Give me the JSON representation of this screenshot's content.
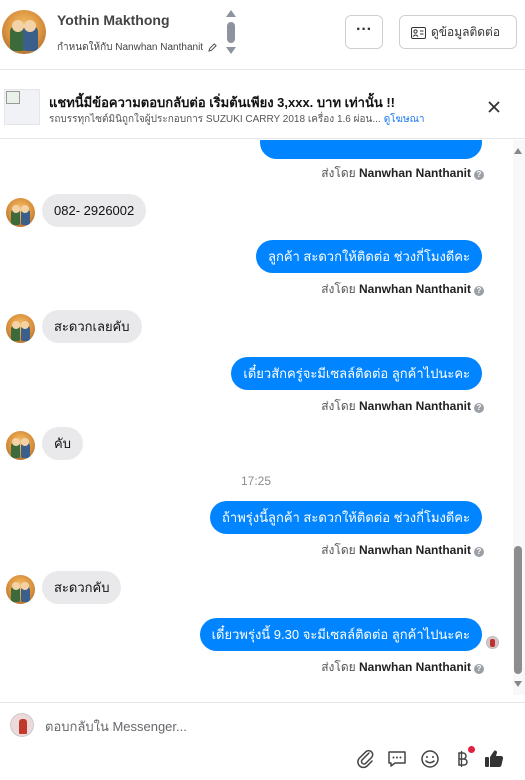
{
  "header": {
    "contact_name": "Yothin Makthong",
    "assigned_text": "กำหนดให้กับ Nanwhan Nanthanit",
    "more_label": "···",
    "info_label": "ดูข้อมูลติดต่อ"
  },
  "ad": {
    "title": "แชทนี้มีข้อความตอบกลับต่อ เริ่มต้นเพียง 3,xxx. บาท เท่านั้น !!",
    "description": "รถบรรทุกไซต์มินิถูกใจผู้ประกอบการ SUZUKI CARRY 2018 เครื่อง 1.6 ผ่อน...",
    "link": "ดูโฆษณา"
  },
  "messages": [
    {
      "dir": "out",
      "text": "",
      "partial": true
    },
    {
      "dir": "sent_by",
      "prefix": "ส่งโดย",
      "name": "Nanwhan Nanthanit"
    },
    {
      "dir": "in",
      "text": "082- 2926002"
    },
    {
      "dir": "out",
      "text": "ลูกค้า สะดวกให้ติดต่อ ช่วงกี่โมงดีคะ"
    },
    {
      "dir": "sent_by",
      "prefix": "ส่งโดย",
      "name": "Nanwhan Nanthanit"
    },
    {
      "dir": "in",
      "text": "สะดวกเลยคับ"
    },
    {
      "dir": "out",
      "text": "เดี๋ยวสักครู่จะมีเซลล์ติดต่อ ลูกค้าไปนะคะ"
    },
    {
      "dir": "sent_by",
      "prefix": "ส่งโดย",
      "name": "Nanwhan Nanthanit"
    },
    {
      "dir": "in",
      "text": "คับ"
    },
    {
      "dir": "time",
      "text": "17:25"
    },
    {
      "dir": "out",
      "text": "ถ้าพรุ่งนี้ลูกค้า สะดวกให้ติดต่อ ช่วงกี่โมงดีคะ"
    },
    {
      "dir": "sent_by",
      "prefix": "ส่งโดย",
      "name": "Nanwhan Nanthanit"
    },
    {
      "dir": "in",
      "text": "สะดวกคับ"
    },
    {
      "dir": "out",
      "text": "เดี๋ยวพรุ่งนี้ 9.30 จะมีเซลล์ติดต่อ ลูกค้าไปนะคะ"
    },
    {
      "dir": "sent_by",
      "prefix": "ส่งโดย",
      "name": "Nanwhan Nanthanit"
    }
  ],
  "composer": {
    "placeholder": "ตอบกลับใน Messenger..."
  },
  "colors": {
    "outgoing_bubble": "#0084ff",
    "incoming_bubble": "#e9e9eb",
    "link": "#1877f2",
    "notify": "#e41e3f"
  },
  "icons": [
    "pencil-icon",
    "contact-card-icon",
    "close-icon",
    "help-icon",
    "attachment-icon",
    "saved-reply-icon",
    "emoji-icon",
    "baht-payment-icon",
    "like-icon"
  ]
}
